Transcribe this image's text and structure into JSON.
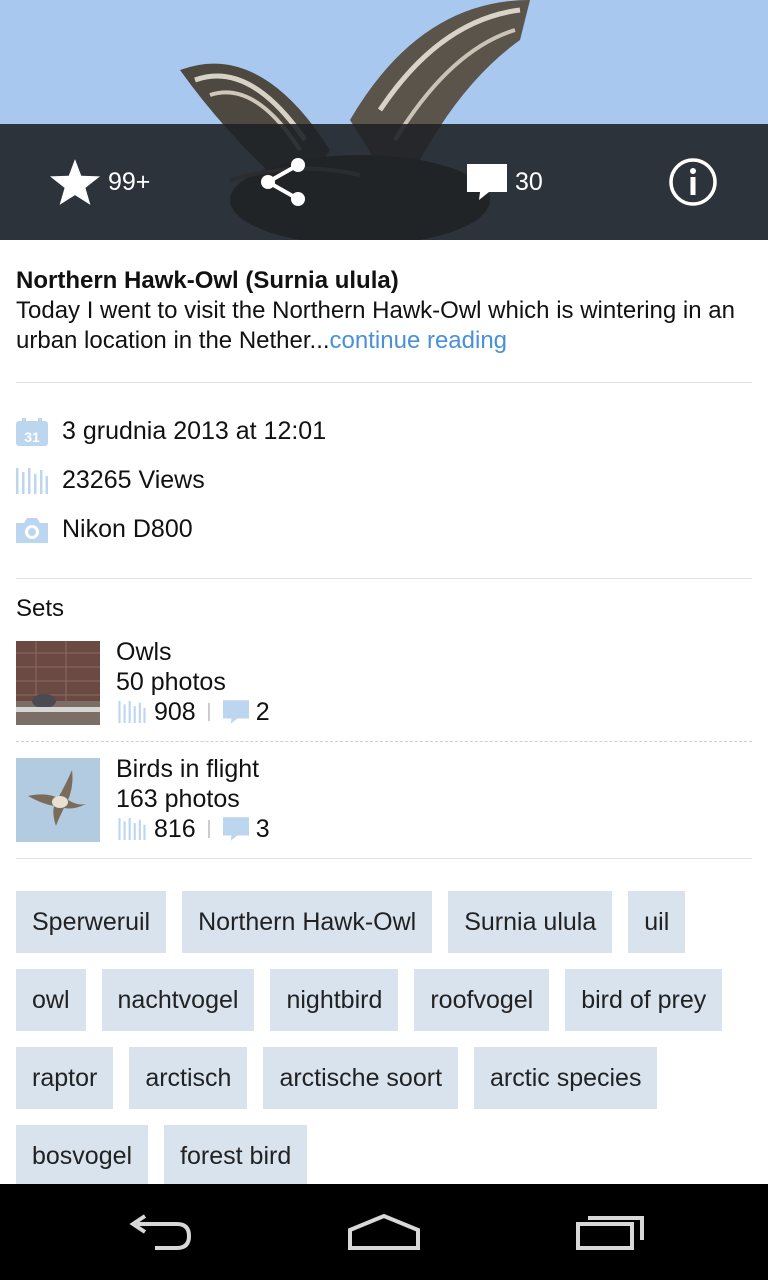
{
  "actions": {
    "favorites_count": "99+",
    "comments_count": "30"
  },
  "photo": {
    "title": "Northern Hawk-Owl (Surnia ulula)",
    "description": "Today I went to visit the Northern Hawk-Owl which is wintering in an urban location in the Nether...",
    "continue_label": "continue reading"
  },
  "meta": {
    "date": "3 grudnia 2013 at 12:01",
    "views": "23265 Views",
    "camera": "Nikon D800",
    "calendar_day": "31"
  },
  "sets": {
    "heading": "Sets",
    "items": [
      {
        "name": "Owls",
        "photos": "50 photos",
        "views": "908",
        "comments": "2"
      },
      {
        "name": "Birds in flight",
        "photos": "163 photos",
        "views": "816",
        "comments": "3"
      }
    ]
  },
  "tags": [
    "Sperweruil",
    "Northern Hawk-Owl",
    "Surnia ulula",
    "uil",
    "owl",
    "nachtvogel",
    "nightbird",
    "roofvogel",
    "bird of prey",
    "raptor",
    "arctisch",
    "arctische soort",
    "arctic species",
    "bosvogel",
    "forest bird"
  ],
  "colors": {
    "accent": "#4a90d9",
    "tag_bg": "#d9e3ee",
    "actionbar": "#1f2227",
    "icon_blue": "#bcd6f0"
  },
  "icons": [
    "star-icon",
    "share-icon",
    "comment-icon",
    "info-icon",
    "calendar-icon",
    "views-icon",
    "camera-icon",
    "back-icon",
    "home-icon",
    "recents-icon"
  ]
}
